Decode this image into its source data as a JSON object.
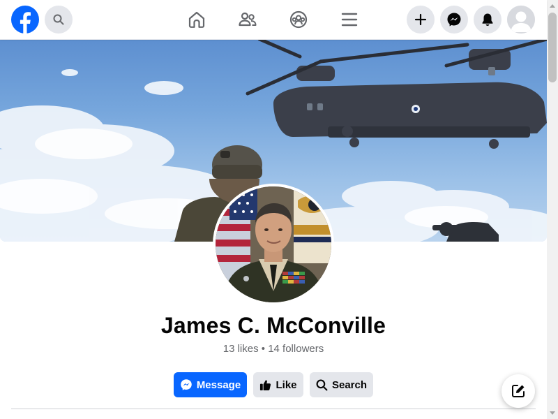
{
  "nav": {
    "logo": "facebook-logo",
    "search_icon": "search-icon",
    "center_icons": [
      "home-icon",
      "friends-icon",
      "groups-icon",
      "menu-icon"
    ],
    "right_icons": [
      "plus-icon",
      "messenger-icon",
      "bell-icon",
      "account-avatar"
    ]
  },
  "profile": {
    "name": "James C. McConville",
    "stats": "13 likes • 14 followers"
  },
  "actions": {
    "message_label": "Message",
    "like_label": "Like",
    "search_label": "Search"
  },
  "colors": {
    "brand": "#0866ff",
    "secondary_button": "#e4e6eb",
    "muted_text": "#65676b"
  }
}
